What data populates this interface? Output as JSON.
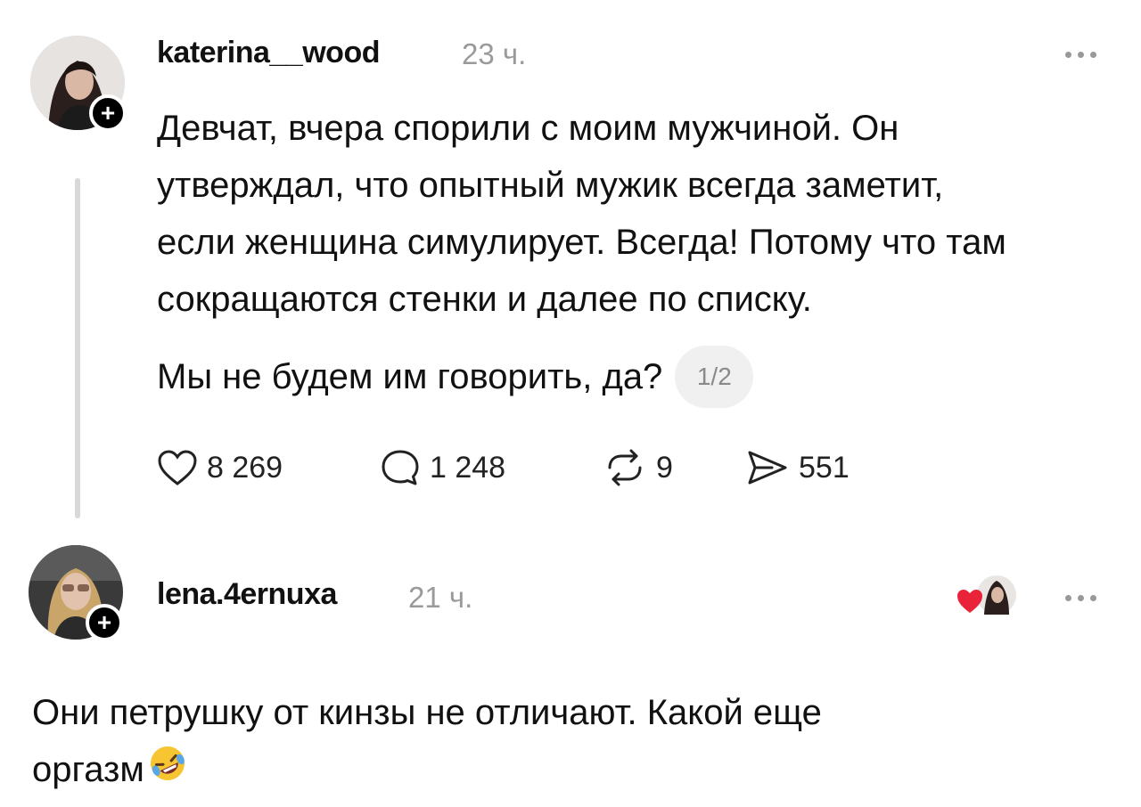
{
  "post": {
    "username": "katerina__wood",
    "time": "23 ч.",
    "follow_symbol": "+",
    "paragraph_lines": [
      "Девчат, вчера спорили с моим мужчиной. Он",
      "утверждал, что опытный мужик всегда заметит,",
      "если женщина симулирует. Всегда! Потому что там",
      "сокращаются стенки и далее по списку."
    ],
    "paragraph2": "Мы не будем им говорить, да?",
    "page_indicator": "1/2",
    "actions": {
      "likes": "8 269",
      "comments": "1 248",
      "reposts": "9",
      "shares": "551"
    }
  },
  "reply": {
    "username": "lena.4ernuxa",
    "time": "21 ч.",
    "follow_symbol": "+",
    "text_line1": "Они петрушку от кинзы не отличают. Какой еще",
    "text_line2": "оргазм"
  },
  "colors": {
    "text": "#111111",
    "muted": "#9a9a9a",
    "thread_line": "#d8d8d8",
    "heart_red": "#e8233a"
  },
  "icons": [
    "heart-icon",
    "comment-icon",
    "repost-icon",
    "share-icon",
    "more-icon",
    "rofl-emoji-icon"
  ]
}
